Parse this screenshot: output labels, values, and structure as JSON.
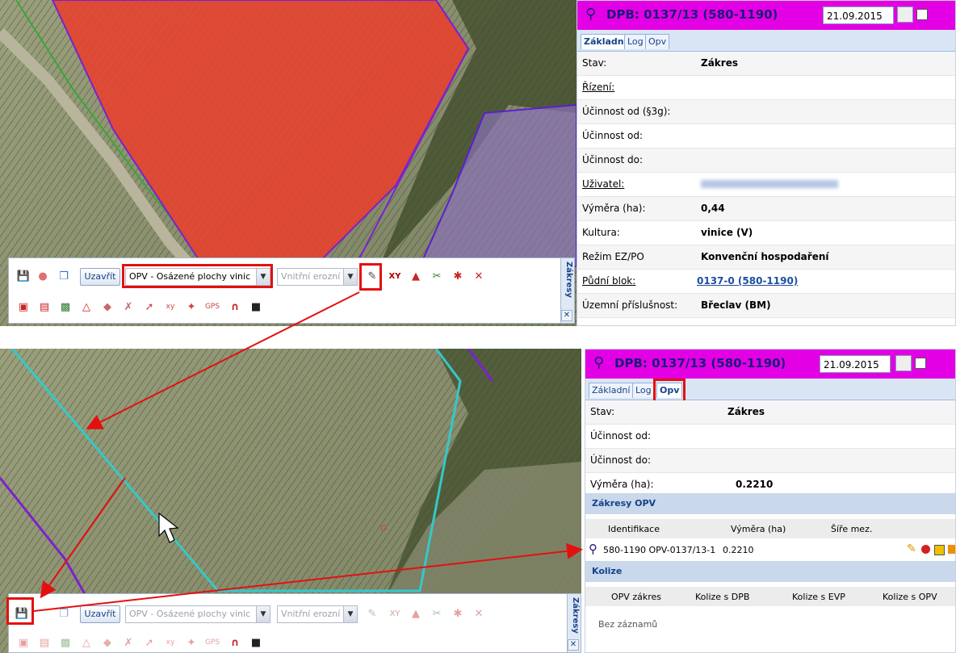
{
  "toolbar": {
    "close_label": "Uzavřít",
    "layer_select": "OPV - Osázené plochy vinic",
    "erosion_select": "Vnitřní erozní poze",
    "side_label": "Zákresy",
    "close_icon": "✕"
  },
  "panel": {
    "title": "DPB: 0137/13 (580-1190)",
    "date": "21.09.2015",
    "tabs": [
      "Základní",
      "Log",
      "Opv"
    ]
  },
  "basic": {
    "rows": [
      {
        "label": "Stav:",
        "value": "Zákres"
      },
      {
        "label": "Řízení:",
        "value": ""
      },
      {
        "label": "Účinnost od (§3g):",
        "value": ""
      },
      {
        "label": "Účinnost od:",
        "value": ""
      },
      {
        "label": "Účinnost do:",
        "value": ""
      },
      {
        "label": "Uživatel:",
        "value": ""
      },
      {
        "label": "Výměra (ha):",
        "value": "0,44"
      },
      {
        "label": "Kultura:",
        "value": "vinice (V)"
      },
      {
        "label": "Režim EZ/PO",
        "value": "Konvenční hospodaření"
      },
      {
        "label": "Půdní blok:",
        "value": "0137-0 (580-1190)"
      },
      {
        "label": "Územní příslušnost:",
        "value": "Břeclav (BM)"
      }
    ]
  },
  "opv": {
    "rows": [
      {
        "label": "Stav:",
        "value": "Zákres"
      },
      {
        "label": "Účinnost od:",
        "value": ""
      },
      {
        "label": "Účinnost do:",
        "value": ""
      },
      {
        "label": "Výměra (ha):",
        "value": "0.2210"
      }
    ],
    "zakresy_title": "Zákresy OPV",
    "zakresy_cols": [
      "Identifikace",
      "Výměra (ha)",
      "Šíře mez."
    ],
    "zakresy_row": {
      "id": "580-1190 OPV-0137/13-1",
      "area": "0.2210"
    },
    "kolize_title": "Kolize",
    "kolize_cols": [
      "OPV zákres",
      "Kolize s DPB",
      "Kolize s EVP",
      "Kolize s OPV"
    ],
    "empty": "Bez záznamů"
  },
  "colors": {
    "header": "#e400e4",
    "highlight": "#e41010",
    "parcel": "#e8402e",
    "opv_line": "#36c8c8",
    "boundary": "#7a22d0"
  }
}
